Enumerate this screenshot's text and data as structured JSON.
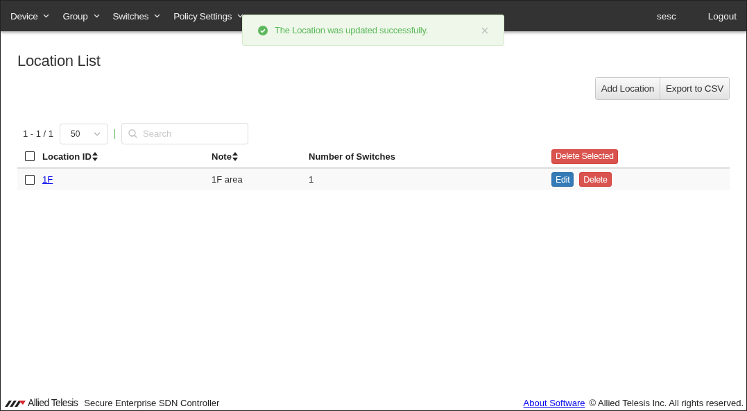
{
  "nav": {
    "menus": [
      {
        "label": "Device",
        "dropdown": true
      },
      {
        "label": "Group",
        "dropdown": true
      },
      {
        "label": "Switches",
        "dropdown": true
      },
      {
        "label": "Policy Settings",
        "dropdown": true
      }
    ],
    "user": "sesc",
    "logout": "Logout"
  },
  "toast": {
    "message": "The Location was updated successfully."
  },
  "page": {
    "title": "Location List",
    "actions": [
      "Add Location",
      "Export to CSV"
    ]
  },
  "pager": {
    "range": "1 - 1 / 1",
    "page_size": "50",
    "search_placeholder": "Search"
  },
  "table": {
    "columns": [
      {
        "label": "Location ID",
        "sortable": true
      },
      {
        "label": "Note",
        "sortable": true
      },
      {
        "label": "Number of Switches",
        "sortable": false
      }
    ],
    "bulk_action": "Delete Selected",
    "all_checked": false,
    "rows": [
      {
        "checked": false,
        "location_id": "1F",
        "note": "1F area",
        "switches": "1",
        "actions": [
          {
            "label": "Edit",
            "kind": "primary"
          },
          {
            "label": "Delete",
            "kind": "danger"
          }
        ]
      }
    ]
  },
  "footer": {
    "brand": "Allied Telesis",
    "product": "Secure Enterprise SDN Controller",
    "link": "About Software",
    "copyright": "© Allied Telesis Inc. All rights reserved."
  }
}
